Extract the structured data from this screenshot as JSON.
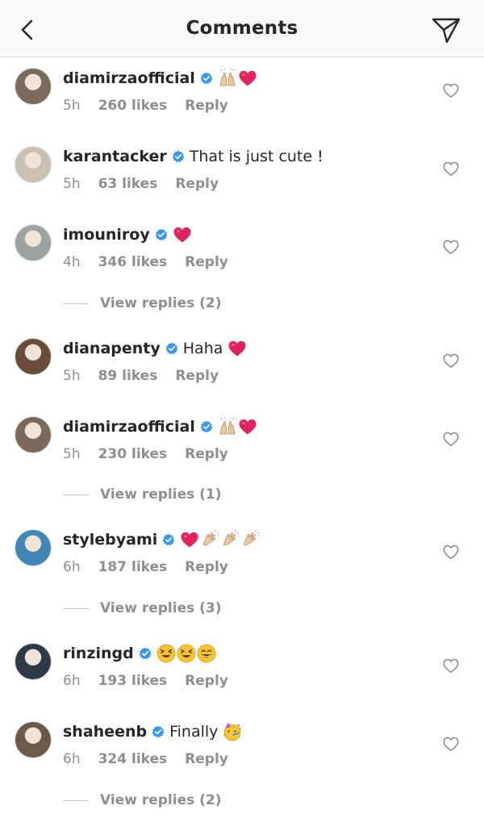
{
  "header": {
    "title": "Comments",
    "back_icon": "chevron-left-icon",
    "send_icon": "paper-plane-icon"
  },
  "comments": [
    {
      "username": "diamirzaofficial",
      "verified": true,
      "text": "",
      "emojis": [
        "raised-hands",
        "red-heart"
      ],
      "time": "5h",
      "likes": "260 likes",
      "reply": "Reply",
      "avatar_color": "#7a6a5c"
    },
    {
      "username": "karantacker",
      "verified": true,
      "text": "That is just cute !",
      "emojis": [],
      "time": "5h",
      "likes": "63 likes",
      "reply": "Reply",
      "avatar_color": "#c9bfb3"
    },
    {
      "username": "imouniroy",
      "verified": true,
      "text": "",
      "emojis": [
        "red-heart"
      ],
      "time": "4h",
      "likes": "346 likes",
      "reply": "Reply",
      "avatar_color": "#9aa3a0"
    },
    {
      "username": "dianapenty",
      "verified": true,
      "text": "Haha",
      "emojis": [
        "red-heart"
      ],
      "time": "5h",
      "likes": "89 likes",
      "reply": "Reply",
      "avatar_color": "#6b4b3a"
    },
    {
      "username": "diamirzaofficial",
      "verified": true,
      "text": "",
      "emojis": [
        "raised-hands",
        "red-heart"
      ],
      "time": "5h",
      "likes": "230 likes",
      "reply": "Reply",
      "avatar_color": "#7a6a5c"
    },
    {
      "username": "stylebyami",
      "verified": true,
      "text": "",
      "emojis": [
        "red-heart",
        "clapping-hands",
        "clapping-hands",
        "clapping-hands"
      ],
      "time": "6h",
      "likes": "187 likes",
      "reply": "Reply",
      "avatar_color": "#3f86b5"
    },
    {
      "username": "rinzingd",
      "verified": true,
      "text": "",
      "emojis": [
        "squinting-face",
        "squinting-face",
        "grinning-face"
      ],
      "time": "6h",
      "likes": "193 likes",
      "reply": "Reply",
      "avatar_color": "#2e3a4a"
    },
    {
      "username": "shaheenb",
      "verified": true,
      "text": "Finally",
      "emojis": [
        "partying-face"
      ],
      "time": "6h",
      "likes": "324 likes",
      "reply": "Reply",
      "avatar_color": "#6b5a4a"
    }
  ],
  "view_replies": {
    "imouniroy": "View replies (2)",
    "diamirzaofficial_2": "View replies (1)",
    "stylebyami": "View replies (3)",
    "shaheenb": "View replies (2)"
  },
  "colors": {
    "verified": "#3897f0",
    "muted": "#8e8e8e",
    "text": "#262626",
    "heart_emoji": "#e0245e"
  }
}
